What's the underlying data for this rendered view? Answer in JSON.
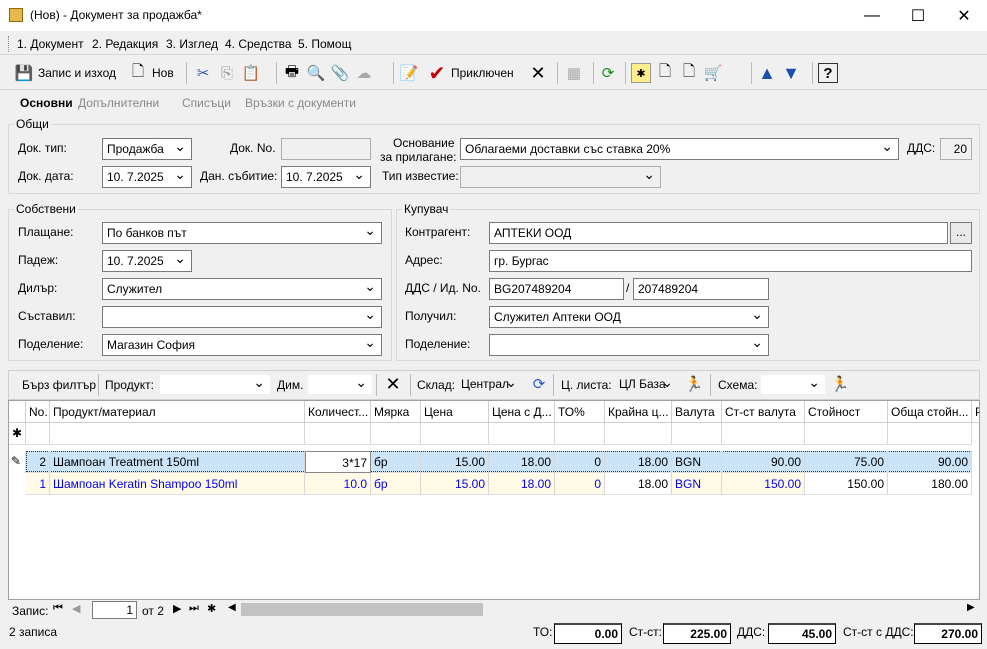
{
  "window": {
    "title": "(Нов) - Документ за продажба*"
  },
  "menu": [
    "1. Документ",
    "2. Редакция",
    "3. Изглед",
    "4. Средства",
    "5. Помощ"
  ],
  "toolbar": {
    "save_exit": "Запис и изход",
    "new": "Нов",
    "finished": "Приключен"
  },
  "tabs": [
    "Основни",
    "Допълнителни",
    "Списъци",
    "Връзки с документи"
  ],
  "general": {
    "legend": "Общи",
    "doc_type_label": "Док. тип:",
    "doc_type": "Продажба",
    "doc_no_label": "Док. No.",
    "doc_no": "",
    "basis_label_1": "Основание",
    "basis_label_2": "за прилагане:",
    "basis": "Облагаеми доставки със ставка 20%",
    "vat_label": "ДДС:",
    "vat": "20",
    "doc_date_label": "Док. дата:",
    "doc_date": "10.  7.2025",
    "tax_event_label": "Дан. събитие:",
    "tax_event": "10.  7.2025",
    "notice_type_label": "Тип известие:",
    "notice_type": ""
  },
  "own": {
    "legend": "Собствени",
    "payment_label": "Плащане:",
    "payment": "По банков път",
    "due_label": "Падеж:",
    "due": "10.  7.2025",
    "dealer_label": "Дилър:",
    "dealer": "Служител",
    "author_label": "Съставил:",
    "author": "",
    "division_label": "Поделение:",
    "division": "Магазин София"
  },
  "buyer": {
    "legend": "Купувач",
    "partner_label": "Контрагент:",
    "partner": "АПТЕКИ ООД",
    "browse": "...",
    "address_label": "Адрес:",
    "address": "гр. Бургас",
    "vat_id_label": "ДДС / Ид. No.",
    "vat_no": "BG207489204",
    "slash": "/",
    "id_no": "207489204",
    "receiver_label": "Получил:",
    "receiver": "Служител Аптеки ООД",
    "division_label": "Поделение:",
    "division": ""
  },
  "filter": {
    "quick_filter": "Бърз филтър",
    "product_label": "Продукт:",
    "product": "",
    "dim_label": "Дим.",
    "dim": "",
    "warehouse_label": "Склад:",
    "warehouse": "Централ",
    "pricelist_label": "Ц. листа:",
    "pricelist": "ЦЛ База",
    "scheme_label": "Схема:",
    "scheme": ""
  },
  "grid": {
    "columns": [
      "No.",
      "Продукт/материал",
      "Количест...",
      "Мярка",
      "Цена",
      "Цена с Д...",
      "ТО%",
      "Крайна ц...",
      "Валута",
      "Ст-ст валута",
      "Стойност",
      "Обща стойн...",
      "Р"
    ],
    "new_row_marker": "✱",
    "edit_marker": "✎",
    "rows": [
      {
        "no": "2",
        "product": "Шампоан Treatment 150ml",
        "qty": "3*17",
        "unit": "бр",
        "price": "15.00",
        "price_vat": "18.00",
        "discount": "0",
        "final": "18.00",
        "currency": "BGN",
        "value_cur": "90.00",
        "value": "75.00",
        "total": "90.00"
      },
      {
        "no": "1",
        "product": "Шампоан Keratin Shampoo 150ml",
        "qty": "10.0",
        "unit": "бр",
        "price": "15.00",
        "price_vat": "18.00",
        "discount": "0",
        "final": "18.00",
        "currency": "BGN",
        "value_cur": "150.00",
        "value": "150.00",
        "total": "180.00"
      }
    ]
  },
  "navigator": {
    "label": "Запис:",
    "current": "1",
    "of": "от 2"
  },
  "status": {
    "records": "2 записа",
    "to_label": "ТО:",
    "to": "0.00",
    "cost_label": "Ст-ст:",
    "cost": "225.00",
    "vat_label": "ДДС:",
    "vat": "45.00",
    "cost_vat_label": "Ст-ст с ДДС:",
    "cost_vat": "270.00"
  },
  "colors": {
    "selected_row": "#cce4f7",
    "modified_row": "#fffbe6",
    "blue_text": "#0000ff",
    "toolbar_blue": "#1a4fb0"
  }
}
